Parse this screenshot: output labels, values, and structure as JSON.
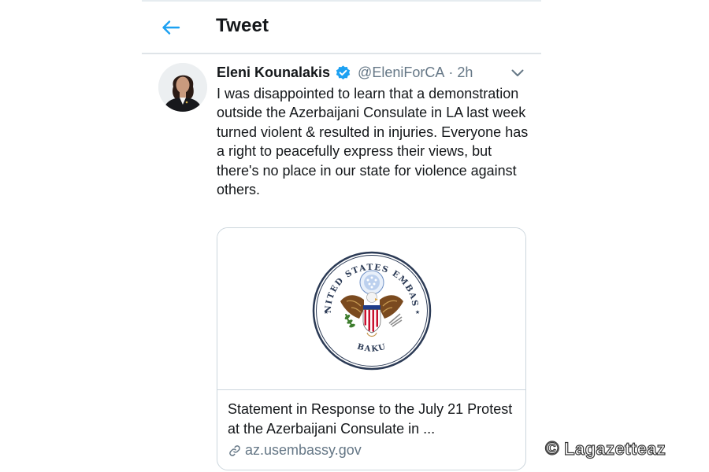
{
  "header": {
    "title": "Tweet",
    "back_icon": "arrow-left-icon"
  },
  "tweet": {
    "author_name": "Eleni Kounalakis",
    "verified_icon": "verified-badge-icon",
    "handle": "@EleniForCA",
    "separator": "·",
    "time": "2h",
    "menu_icon": "chevron-down-icon",
    "text": "I was disappointed to learn that a demonstration outside the Azerbaijani Consulate in LA last week turned violent & resulted in injuries. Everyone has a right to peacefully express their views, but there's no place in our state for violence against others."
  },
  "card": {
    "seal_top_text": "UNITED STATES EMBASSY",
    "seal_bottom_text": "BAKU",
    "title": "Statement in Response to the July 21 Protest at the Azerbaijani Consulate in ...",
    "link_icon": "link-icon",
    "domain": "az.usembassy.gov"
  },
  "watermark": {
    "symbol": "©",
    "text": "Lagazetteaz"
  },
  "colors": {
    "accent": "#1da1f2",
    "text": "#14171a",
    "muted": "#657786",
    "border": "#ccd6dd"
  }
}
